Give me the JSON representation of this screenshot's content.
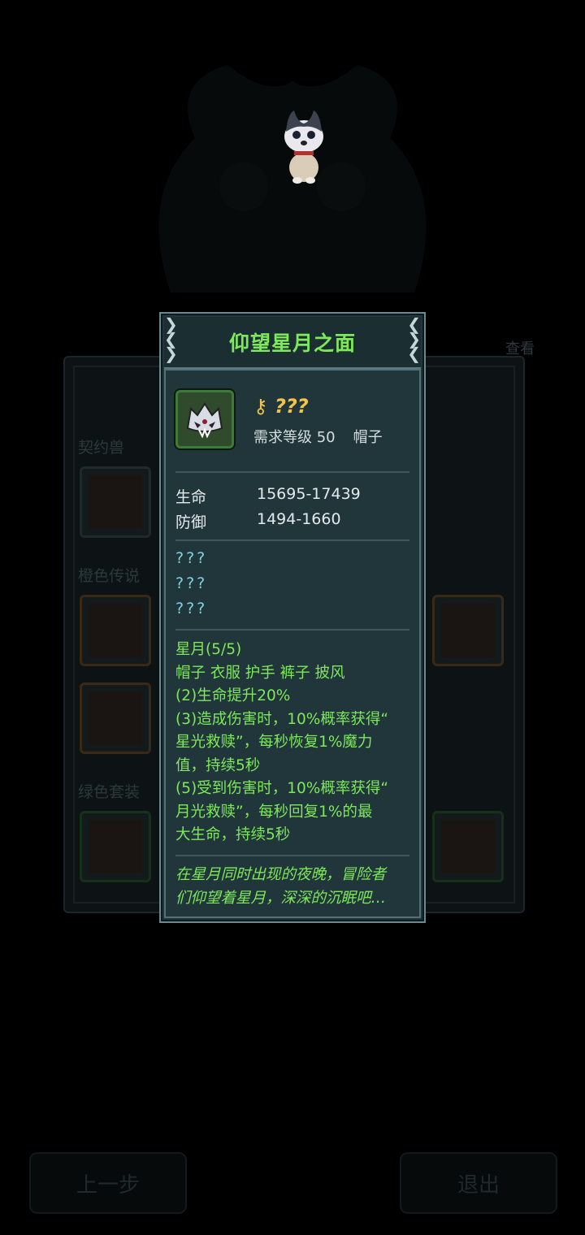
{
  "background": {
    "sections": [
      "契约兽",
      "橙色传说",
      "绿色套装"
    ],
    "view_label": "查看",
    "buttons": {
      "prev": "上一步",
      "exit": "退出"
    }
  },
  "tooltip": {
    "title": "仰望星月之面",
    "quality_icon": "key-icon",
    "quality": "???",
    "requirement": "需求等级 50",
    "slot": "帽子",
    "stats": [
      {
        "label": "生命",
        "value": "15695-17439"
      },
      {
        "label": "防御",
        "value": "1494-1660"
      }
    ],
    "unknown_affixes": [
      "???",
      "???",
      "???"
    ],
    "set": {
      "name": "星月(5/5)",
      "pieces": "帽子 衣服 护手 裤子 披风",
      "lines": [
        "(2)生命提升20%",
        "(3)造成伤害时，10%概率获得“",
        "星光救赎”，每秒恢复1%魔力",
        "值，持续5秒",
        "(5)受到伤害时，10%概率获得“",
        "月光救赎”，每秒回复1%的最",
        "大生命，持续5秒"
      ]
    },
    "flavor": [
      "在星月同时出现的夜晚，冒险者",
      "们仰望着星月，深深的沉眠吧…"
    ]
  },
  "colors": {
    "title": "#7de85a",
    "quality": "#f1c34a",
    "unknown": "#7fd3e0",
    "panel": "#21363a"
  }
}
